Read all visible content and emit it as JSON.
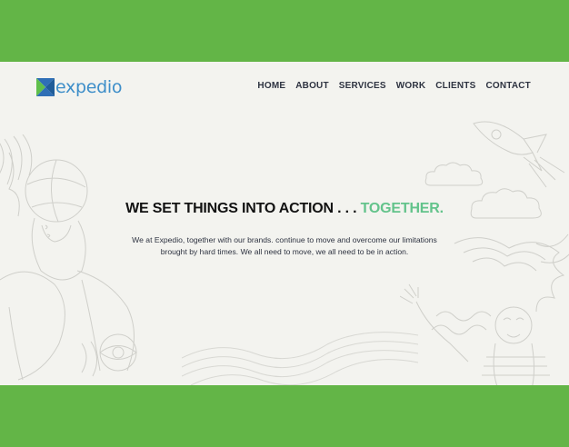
{
  "brand": {
    "name": "expedio",
    "colors": {
      "background": "#63b547",
      "page": "#f3f3ef",
      "logo_text": "#3d8ec9",
      "logo_blue": "#2f6fb6",
      "logo_green": "#5fbf4b",
      "accent": "#63c38b",
      "nav_text": "#2e3341"
    }
  },
  "nav": {
    "items": [
      {
        "label": "HOME"
      },
      {
        "label": "ABOUT"
      },
      {
        "label": "SERVICES"
      },
      {
        "label": "WORK"
      },
      {
        "label": "CLIENTS"
      },
      {
        "label": "CONTACT"
      }
    ]
  },
  "hero": {
    "headline_main": "WE SET THINGS INTO ACTION . . . ",
    "headline_accent": "TOGETHER.",
    "body_line1": "We at Expedio, together with our brands. continue to move and overcome our limitations",
    "body_line2": "brought by hard times. We all need to move, we all need to be in action."
  },
  "icons": {
    "logo": "expedio-x-logo-icon"
  }
}
